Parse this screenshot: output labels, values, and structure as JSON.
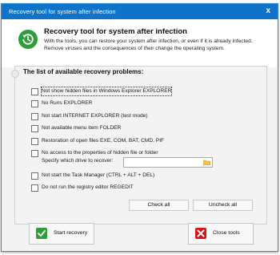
{
  "window": {
    "title": "Recovery tool for system after infection",
    "close_glyph": "x"
  },
  "header": {
    "icon": "restore-clock-icon",
    "title": "Recovery tool for system after infection",
    "description": "With the tools, you can restore your system after infection, or even if it is already infected. Remove viruses and the consequences of their change the operating system."
  },
  "panel": {
    "title": "The list of available recovery problems:"
  },
  "options": [
    {
      "label": "Not show hidden files in Windows Explorer EXPLORER",
      "checked": false
    },
    {
      "label": "No Runs EXPLORER",
      "checked": false
    },
    {
      "label": "Not start INTERNET EXPLORER (test mode)",
      "checked": false
    },
    {
      "label": "Not available menu item FOLDER",
      "checked": false
    },
    {
      "label": "Restoration of open files EXE, COM, BAT, CMD, PIF",
      "checked": false
    },
    {
      "label": "No access to the properties of hidden file or folder",
      "checked": false
    },
    {
      "label": "Not start the Task Manager (CTRL + ALT + DEL)",
      "checked": false
    },
    {
      "label": "Do not run the registry editor REGEDIT",
      "checked": false
    }
  ],
  "drive": {
    "label": "Specify which drive to recover:",
    "value": "",
    "icon": "folder-icon"
  },
  "buttons": {
    "check_all": "Check all",
    "uncheck_all": "Uncheck all",
    "start_recovery": "Start recovery",
    "close_tools": "Close tools"
  },
  "colors": {
    "titlebar": "#0f73c9",
    "accent_green": "#2e9e3a",
    "accent_red": "#d9141b"
  }
}
